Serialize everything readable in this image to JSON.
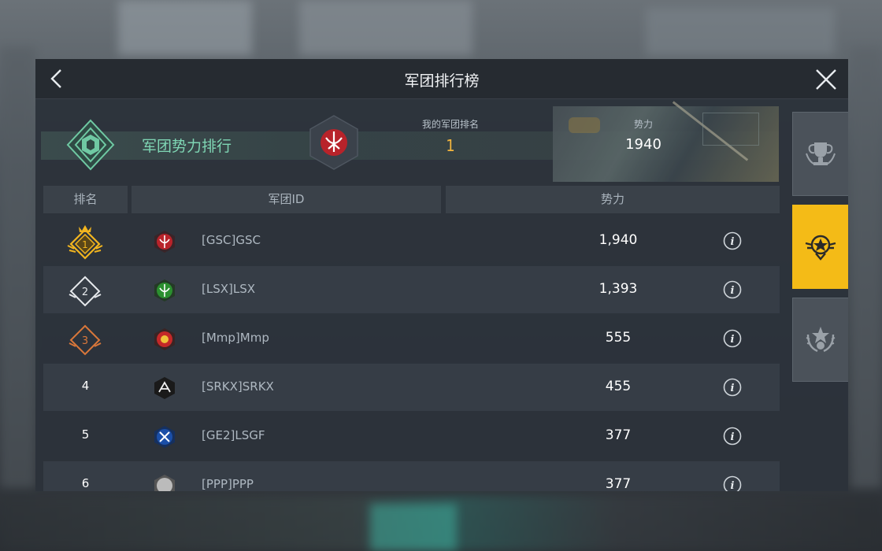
{
  "header": {
    "title": "军团排行榜"
  },
  "banner": {
    "label": "军团势力排行",
    "my_rank_caption": "我的军团排名",
    "my_rank_value": "1",
    "power_caption": "势力",
    "power_value": "1940"
  },
  "table": {
    "columns": [
      "排名",
      "军团ID",
      "势力"
    ],
    "rows": [
      {
        "rank": "1",
        "legion": "[GSC]GSC",
        "power": "1,940",
        "emblem_color": "#b8232a"
      },
      {
        "rank": "2",
        "legion": "[LSX]LSX",
        "power": "1,393",
        "emblem_color": "#2b8f2f"
      },
      {
        "rank": "3",
        "legion": "[Mmp]Mmp",
        "power": "555",
        "emblem_color": "#c42828"
      },
      {
        "rank": "4",
        "legion": "[SRKX]SRKX",
        "power": "455",
        "emblem_color": "#1a1a1a"
      },
      {
        "rank": "5",
        "legion": "[GE2]LSGF",
        "power": "377",
        "emblem_color": "#1b4fa8"
      },
      {
        "rank": "6",
        "legion": "[PPP]PPP",
        "power": "377",
        "emblem_color": "#888888"
      }
    ]
  },
  "side_tabs": [
    {
      "icon": "trophy-icon",
      "active": false
    },
    {
      "icon": "star-medal-icon",
      "active": true
    },
    {
      "icon": "wreath-star-icon",
      "active": false
    }
  ],
  "colors": {
    "accent": "#f4bb17",
    "gold": "#f3b53d",
    "green_label": "#7fd6b4"
  }
}
